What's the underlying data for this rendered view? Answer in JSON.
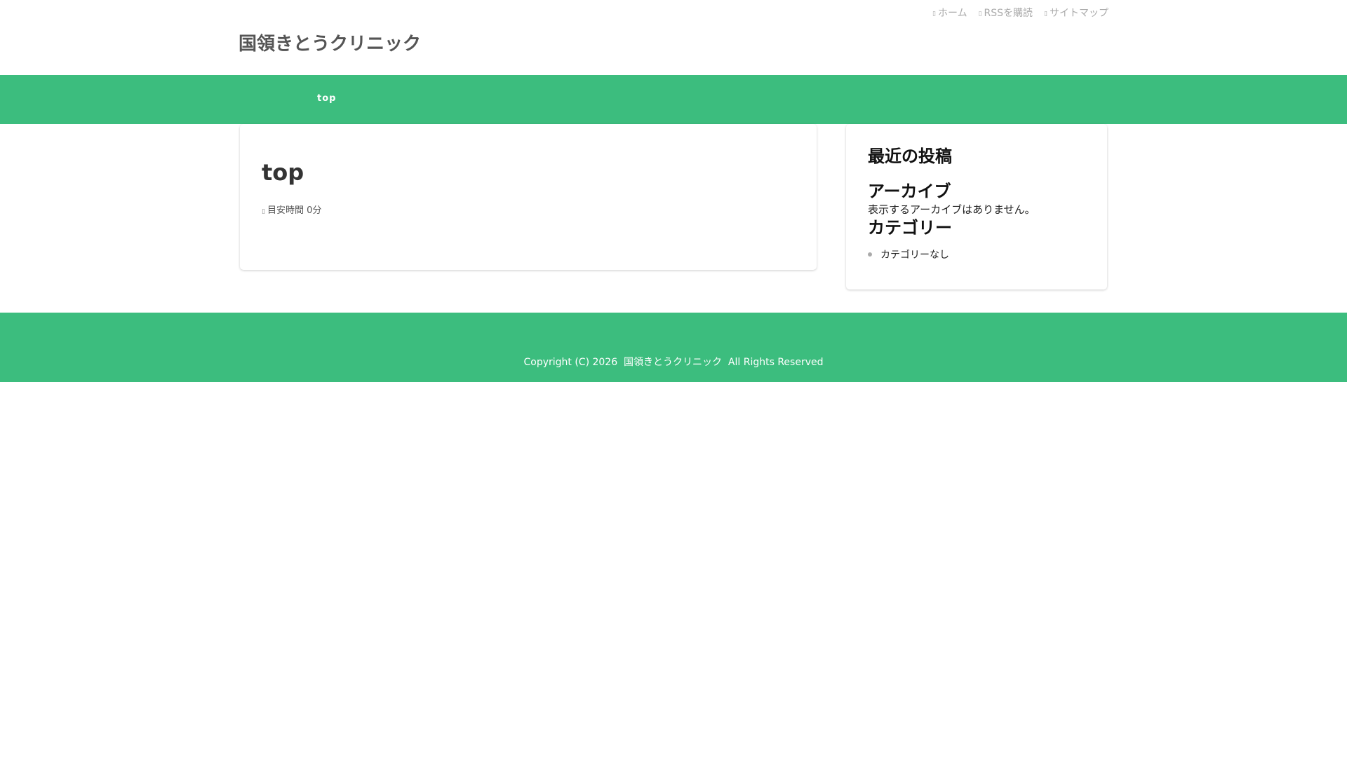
{
  "header": {
    "site_title": "国領きとうクリニック",
    "top_links": [
      {
        "icon": "home-icon",
        "label": "ホーム"
      },
      {
        "icon": "rss-icon",
        "label": "RSSを購読"
      },
      {
        "icon": "sitemap-icon",
        "label": "サイトマップ"
      }
    ]
  },
  "nav": {
    "items": [
      {
        "label": "top"
      }
    ]
  },
  "main": {
    "title": "top",
    "reading_time": "目安時間 0分"
  },
  "sidebar": {
    "recent_posts_heading": "最近の投稿",
    "archive_heading": "アーカイブ",
    "archive_empty": "表示するアーカイブはありません。",
    "category_heading": "カテゴリー",
    "categories": [
      "カテゴリーなし"
    ]
  },
  "footer": {
    "copyright": "Copyright (C) 2026  国領きとうクリニック  All Rights Reserved"
  },
  "colors": {
    "accent": "#3cbd7e"
  }
}
